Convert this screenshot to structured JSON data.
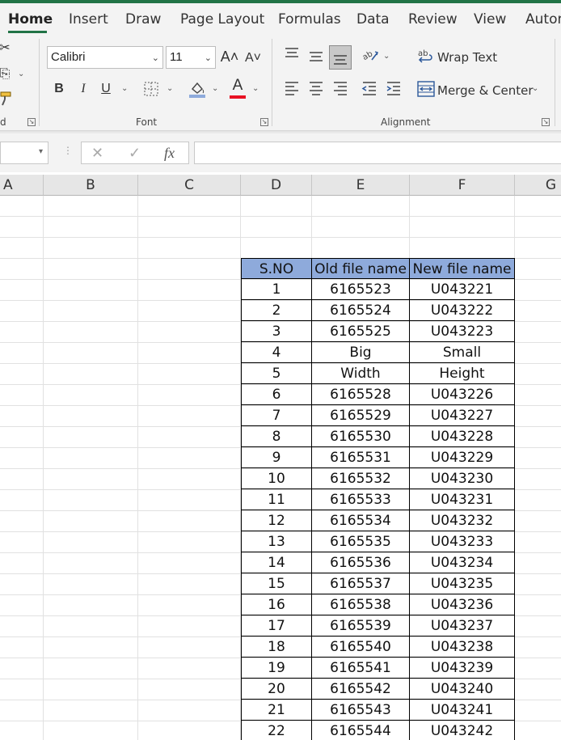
{
  "ribbon": {
    "tabs": [
      "Home",
      "Insert",
      "Draw",
      "Page Layout",
      "Formulas",
      "Data",
      "Review",
      "View",
      "Autom"
    ],
    "active_tab": "Home",
    "clipboard_label": "d",
    "font": {
      "name": "Calibri",
      "size": "11",
      "grow_glyph": "A˄",
      "shrink_glyph": "A˅",
      "bold": "B",
      "italic": "I",
      "underline": "U",
      "font_color_glyph": "A",
      "group_label": "Font",
      "font_color": "#e81123",
      "fill_color": "#8eaadb"
    },
    "alignment": {
      "wrap_text": "Wrap Text",
      "merge_center": "Merge & Center",
      "group_label": "Alignment"
    }
  },
  "formula_bar": {
    "fx": "fx",
    "value": ""
  },
  "columns": [
    "A",
    "B",
    "C",
    "D",
    "E",
    "F",
    "G"
  ],
  "table": {
    "headers": [
      "S.NO",
      "Old file name",
      "New file name"
    ],
    "header_fill": "#8eaadb",
    "rows": [
      [
        "1",
        "6165523",
        "U043221"
      ],
      [
        "2",
        "6165524",
        "U043222"
      ],
      [
        "3",
        "6165525",
        "U043223"
      ],
      [
        "4",
        "Big",
        "Small"
      ],
      [
        "5",
        "Width",
        "Height"
      ],
      [
        "6",
        "6165528",
        "U043226"
      ],
      [
        "7",
        "6165529",
        "U043227"
      ],
      [
        "8",
        "6165530",
        "U043228"
      ],
      [
        "9",
        "6165531",
        "U043229"
      ],
      [
        "10",
        "6165532",
        "U043230"
      ],
      [
        "11",
        "6165533",
        "U043231"
      ],
      [
        "12",
        "6165534",
        "U043232"
      ],
      [
        "13",
        "6165535",
        "U043233"
      ],
      [
        "14",
        "6165536",
        "U043234"
      ],
      [
        "15",
        "6165537",
        "U043235"
      ],
      [
        "16",
        "6165538",
        "U043236"
      ],
      [
        "17",
        "6165539",
        "U043237"
      ],
      [
        "18",
        "6165540",
        "U043238"
      ],
      [
        "19",
        "6165541",
        "U043239"
      ],
      [
        "20",
        "6165542",
        "U043240"
      ],
      [
        "21",
        "6165543",
        "U043241"
      ],
      [
        "22",
        "6165544",
        "U043242"
      ]
    ]
  }
}
